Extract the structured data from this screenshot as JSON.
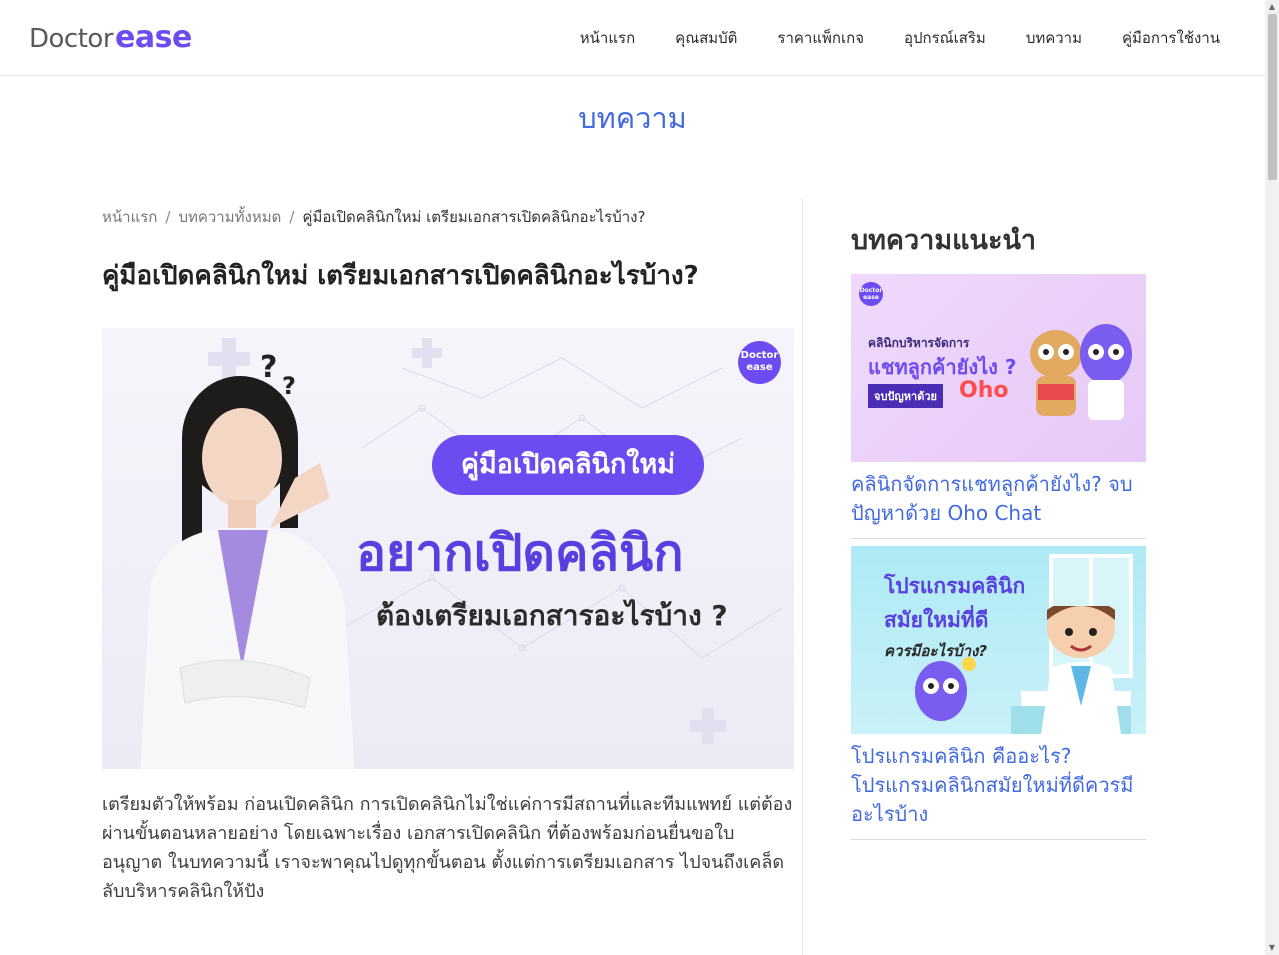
{
  "header": {
    "logo_doctor": "Doctor",
    "logo_ease": "ease",
    "nav": [
      {
        "label": "หน้าแรก"
      },
      {
        "label": "คุณสมบัติ"
      },
      {
        "label": "ราคาแพ็กเกจ"
      },
      {
        "label": "อุปกรณ์เสริม"
      },
      {
        "label": "บทความ"
      },
      {
        "label": "คู่มือการใช้งาน"
      }
    ]
  },
  "page_title": "บทความ",
  "breadcrumb": {
    "home": "หน้าแรก",
    "all_articles": "บทความทั้งหมด",
    "current": "คู่มือเปิดคลินิกใหม่ เตรียมเอกสารเปิดคลินิกอะไรบ้าง?",
    "separator": "/"
  },
  "article": {
    "title": "คู่มือเปิดคลินิกใหม่ เตรียมเอกสารเปิดคลินิกอะไรบ้าง?",
    "hero": {
      "badge_line1": "Doctor",
      "badge_line2": "ease",
      "pill": "คู่มือเปิดคลินิกใหม่",
      "headline": "อยากเปิดคลินิก",
      "subheadline": "ต้องเตรียมเอกสารอะไรบ้าง ?",
      "q1": "?",
      "q2": "?"
    },
    "intro": "เตรียมตัวให้พร้อม ก่อนเปิดคลินิก การเปิดคลินิกไม่ใช่แค่การมีสถานที่และทีมแพทย์ แต่ต้องผ่านขั้นตอนหลายอย่าง โดยเฉพาะเรื่อง เอกสารเปิดคลินิก ที่ต้องพร้อมก่อนยื่นขอใบอนุญาต ในบทความนี้ เราจะพาคุณไปดูทุกขั้นตอน ตั้งแต่การเตรียมเอกสาร ไปจนถึงเคล็ดลับบริหารคลินิกให้ปัง"
  },
  "sidebar": {
    "title": "บทความแนะนำ",
    "cards": [
      {
        "title": "คลินิกจัดการแชทลูกค้ายังไง? จบปัญหาด้วย Oho Chat",
        "img_badge_1": "Doctor",
        "img_badge_2": "ease",
        "img_line1": "คลินิกบริหารจัดการ",
        "img_line2": "แชทลูกค้ายังไง ?",
        "img_line3": "จบปัญหาด้วย",
        "img_brand": "Oho"
      },
      {
        "title": "โปรแกรมคลินิก คืออะไร? โปรแกรมคลินิกสมัยใหม่ที่ดีควรมีอะไรบ้าง",
        "img_line1": "โปรแกรมคลินิก",
        "img_line2": "สมัยใหม่ที่ดี",
        "img_line3": "ควรมีอะไรบ้าง?"
      }
    ]
  },
  "colors": {
    "brand": "#6c4cf0",
    "link": "#4169e1"
  }
}
